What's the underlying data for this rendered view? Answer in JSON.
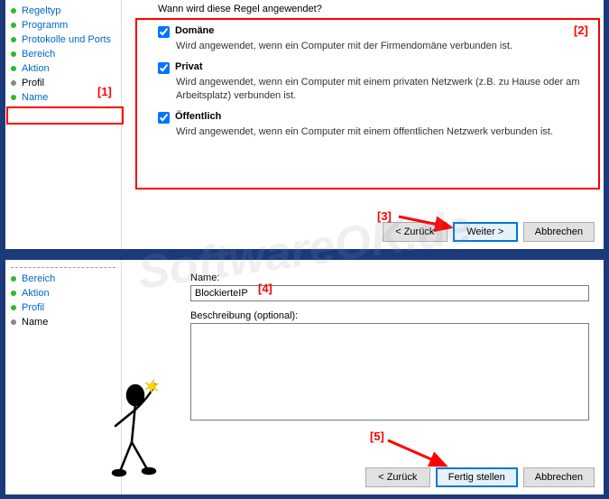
{
  "panel_top": {
    "sidebar": {
      "items": [
        {
          "label": "Regeltyp"
        },
        {
          "label": "Programm"
        },
        {
          "label": "Protokolle und Ports"
        },
        {
          "label": "Bereich"
        },
        {
          "label": "Aktion"
        },
        {
          "label": "Profil"
        },
        {
          "label": "Name"
        }
      ],
      "active_index": 5
    },
    "question": "Wann wird diese Regel angewendet?",
    "checkboxes": [
      {
        "label": "Domäne",
        "desc": "Wird angewendet, wenn ein Computer mit der Firmendomäne verbunden ist.",
        "checked": true
      },
      {
        "label": "Privat",
        "desc": "Wird angewendet, wenn ein Computer mit einem privaten Netzwerk (z.B. zu Hause oder am Arbeitsplatz) verbunden ist.",
        "checked": true
      },
      {
        "label": "Öffentlich",
        "desc": "Wird angewendet, wenn ein Computer mit einem öffentlichen Netzwerk verbunden ist.",
        "checked": true
      }
    ],
    "buttons": {
      "back": "< Zurück",
      "next": "Weiter >",
      "cancel": "Abbrechen"
    }
  },
  "panel_bottom": {
    "sidebar": {
      "items": [
        {
          "label": "Bereich"
        },
        {
          "label": "Aktion"
        },
        {
          "label": "Profil"
        },
        {
          "label": "Name"
        }
      ],
      "active_index": 3
    },
    "name_label": "Name:",
    "name_value": "BlockierteIP",
    "desc_label": "Beschreibung (optional):",
    "desc_value": "",
    "buttons": {
      "back": "< Zurück",
      "finish": "Fertig stellen",
      "cancel": "Abbrechen"
    }
  },
  "annotations": {
    "1": "[1]",
    "2": "[2]",
    "3": "[3]",
    "4": "[4]",
    "5": "[5]"
  },
  "watermark": "SoftwareOK.de"
}
